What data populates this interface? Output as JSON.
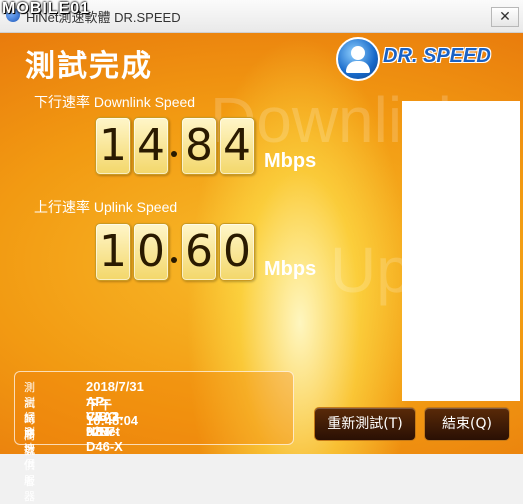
{
  "window": {
    "title": "HiNet測速軟體 DR.SPEED",
    "watermark": "MOBILE01",
    "close_glyph": "✕"
  },
  "header": {
    "title": "測試完成",
    "logo_text": "DR. SPEED"
  },
  "downlink": {
    "label": "下行速率 Downlink Speed",
    "digits": [
      "1",
      "4",
      "8",
      "4"
    ],
    "value": 14.84,
    "unit": "Mbps"
  },
  "uplink": {
    "label": "上行速率 Uplink Speed",
    "digits": [
      "1",
      "0",
      "6",
      "0"
    ],
    "value": 10.6,
    "unit": "Mbps"
  },
  "background_words": [
    "Downlink",
    "Uplink"
  ],
  "info": [
    {
      "key": "測試時間",
      "value": "2018/7/31 下午 10:48:04"
    },
    {
      "key": "測試序號",
      "value": "AP-C8A2-9287-D46-X"
    },
    {
      "key": "網路提供者",
      "value": "VIBO-NET"
    },
    {
      "key": "測速伺服器",
      "value": "HiNet"
    }
  ],
  "buttons": {
    "retest": "重新測試(T)",
    "finish": "結束(Q)"
  },
  "colors": {
    "panel_orange": "#f29a12",
    "digit_face": "#f3d76a",
    "logo_blue": "#1a62c4",
    "button_dark": "#2a1004"
  }
}
